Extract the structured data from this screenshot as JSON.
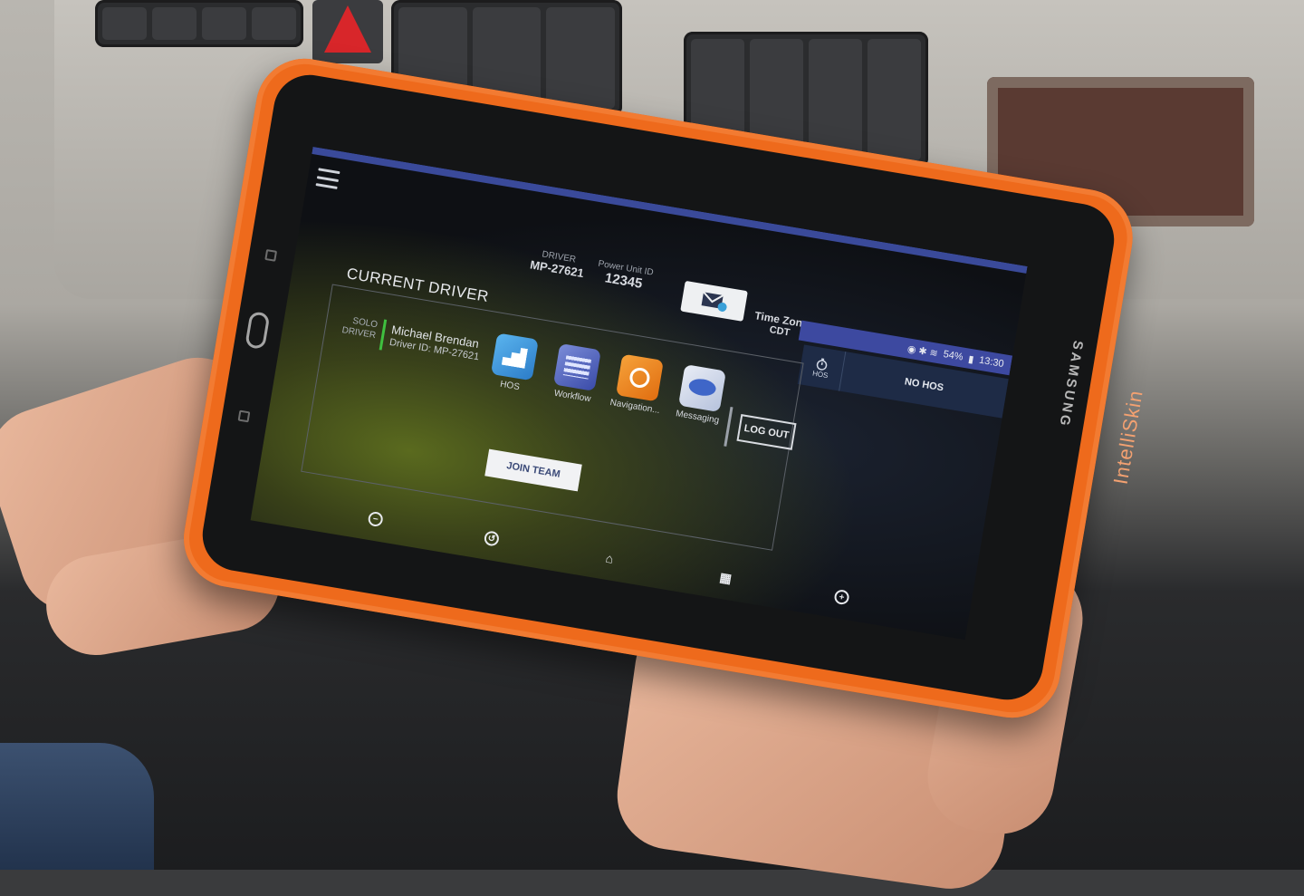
{
  "app": {
    "menu_icon": "hamburger-menu-icon"
  },
  "header": {
    "driver_label": "DRIVER",
    "driver_value": "MP-27621",
    "power_unit_label": "Power Unit ID",
    "power_unit_value": "12345",
    "message_icon": "envelope-icon",
    "time_zone_label": "Time Zone",
    "time_zone_value": "CDT",
    "hos_icon_label": "HOS",
    "hos_status": "NO HOS"
  },
  "status_bar": {
    "battery": "54%",
    "time": "13:30"
  },
  "current_driver": {
    "title": "CURRENT DRIVER",
    "mode_line1": "SOLO",
    "mode_line2": "DRIVER",
    "name": "Michael Brendan",
    "driver_id": "Driver ID: MP-27621",
    "apps": [
      {
        "label": "HOS",
        "icon": "hos-stairs-icon"
      },
      {
        "label": "Workflow",
        "icon": "workflow-icon"
      },
      {
        "label": "Navigation...",
        "icon": "navigation-icon"
      },
      {
        "label": "Messaging",
        "icon": "messaging-icon"
      }
    ],
    "logout_label": "LOG OUT",
    "join_team_label": "JOIN TEAM"
  },
  "nav_bar": {
    "icons": [
      "minus-icon",
      "back-icon",
      "home-icon",
      "apps-grid-icon",
      "plus-icon"
    ]
  },
  "device": {
    "brand": "SAMSUNG",
    "case_brand": "IntelliSkin"
  },
  "colors": {
    "case_orange": "#ee6a1c",
    "header_blue": "#3d49a0",
    "active_green": "#3fbf3f"
  }
}
